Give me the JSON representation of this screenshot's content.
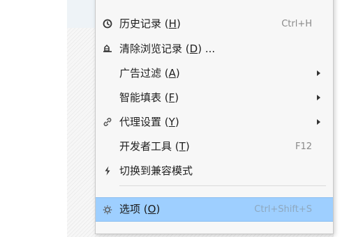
{
  "menu": {
    "items": [
      {
        "id": "history",
        "label": "历史记录",
        "mnemonic": "H",
        "shortcut": "Ctrl+H",
        "icon": "clock-icon",
        "has_submenu": false
      },
      {
        "id": "clear-history",
        "label": "清除浏览记录",
        "mnemonic": "D",
        "suffix": " ...",
        "icon": "eraser-icon",
        "has_submenu": false
      },
      {
        "id": "ad-filter",
        "label": "广告过滤",
        "mnemonic": "A",
        "icon": "",
        "has_submenu": true
      },
      {
        "id": "smart-fill",
        "label": "智能填表",
        "mnemonic": "F",
        "icon": "",
        "has_submenu": true
      },
      {
        "id": "proxy-settings",
        "label": "代理设置",
        "mnemonic": "Y",
        "icon": "link-icon",
        "has_submenu": true
      },
      {
        "id": "developer-tools",
        "label": "开发者工具",
        "mnemonic": "T",
        "shortcut": "F12",
        "icon": "",
        "has_submenu": false
      },
      {
        "id": "switch-compat",
        "label": "切换到兼容模式",
        "icon": "lightning-icon",
        "has_submenu": false
      },
      {
        "id": "options",
        "label": "选项",
        "mnemonic": "O",
        "shortcut": "Ctrl+Shift+S",
        "icon": "gear-icon",
        "has_submenu": false,
        "highlighted": true
      }
    ]
  }
}
